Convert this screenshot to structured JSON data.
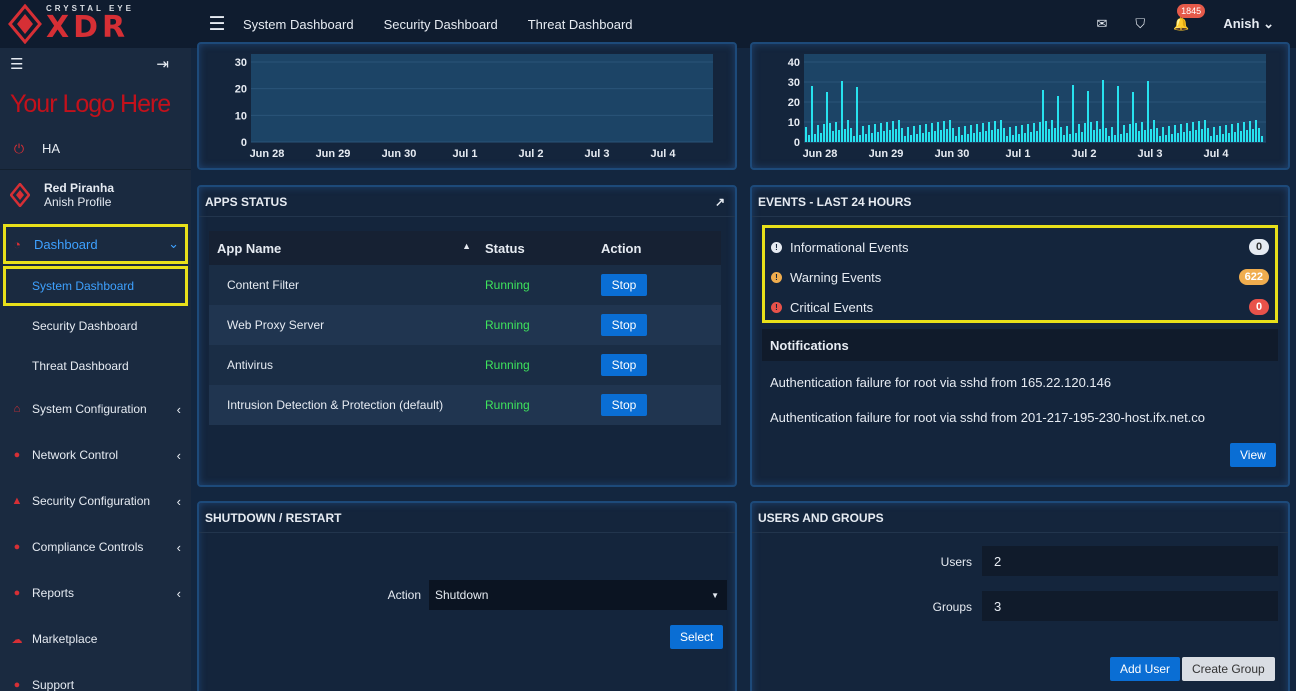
{
  "brand": {
    "small": "CRYSTAL EYE",
    "big": "XDR",
    "custom_logo": "Your Logo Here"
  },
  "sidebar": {
    "ha": "HA",
    "profile_name": "Red Piranha",
    "profile_sub": "Anish Profile",
    "dashboard": "Dashboard",
    "sub_items": [
      "System Dashboard",
      "Security Dashboard",
      "Threat Dashboard"
    ],
    "sections": [
      "System Configuration",
      "Network Control",
      "Security Configuration",
      "Compliance Controls",
      "Reports",
      "Marketplace",
      "Support"
    ]
  },
  "topbar": {
    "links": [
      "System Dashboard",
      "Security Dashboard",
      "Threat Dashboard"
    ],
    "notif_count": "1845",
    "user": "Anish"
  },
  "chart_left": {
    "yticks": [
      "30",
      "20",
      "10",
      "0"
    ],
    "xticks": [
      "Jun 28",
      "Jun 29",
      "Jun 30",
      "Jul 1",
      "Jul 2",
      "Jul 3",
      "Jul 4"
    ]
  },
  "chart_right": {
    "yticks": [
      "40",
      "30",
      "20",
      "10",
      "0"
    ],
    "xticks": [
      "Jun 28",
      "Jun 29",
      "Jun 30",
      "Jul 1",
      "Jul 2",
      "Jul 3",
      "Jul 4"
    ]
  },
  "apps": {
    "title": "APPS STATUS",
    "headers": [
      "App Name",
      "Status",
      "Action"
    ],
    "rows": [
      {
        "name": "Content Filter",
        "status": "Running",
        "action": "Stop"
      },
      {
        "name": "Web Proxy Server",
        "status": "Running",
        "action": "Stop"
      },
      {
        "name": "Antivirus",
        "status": "Running",
        "action": "Stop"
      },
      {
        "name": "Intrusion Detection & Protection (default)",
        "status": "Running",
        "action": "Stop"
      }
    ]
  },
  "events": {
    "title": "EVENTS - LAST 24 HOURS",
    "items": [
      {
        "label": "Informational Events",
        "count": "0",
        "color": "#e6ebf2"
      },
      {
        "label": "Warning Events",
        "count": "622",
        "color": "#f0ad4e"
      },
      {
        "label": "Critical Events",
        "count": "0",
        "color": "#e8524a"
      }
    ],
    "notifications_title": "Notifications",
    "notifications": [
      "Authentication failure for root via sshd from 165.22.120.146",
      "Authentication failure for root via sshd from 201-217-195-230-host.ifx.net.co"
    ],
    "view": "View"
  },
  "shutdown": {
    "title": "SHUTDOWN / RESTART",
    "action_label": "Action",
    "action_value": "Shutdown",
    "select": "Select"
  },
  "users": {
    "title": "USERS AND GROUPS",
    "users_label": "Users",
    "users_value": "2",
    "groups_label": "Groups",
    "groups_value": "3",
    "add_user": "Add User",
    "create_group": "Create Group"
  }
}
